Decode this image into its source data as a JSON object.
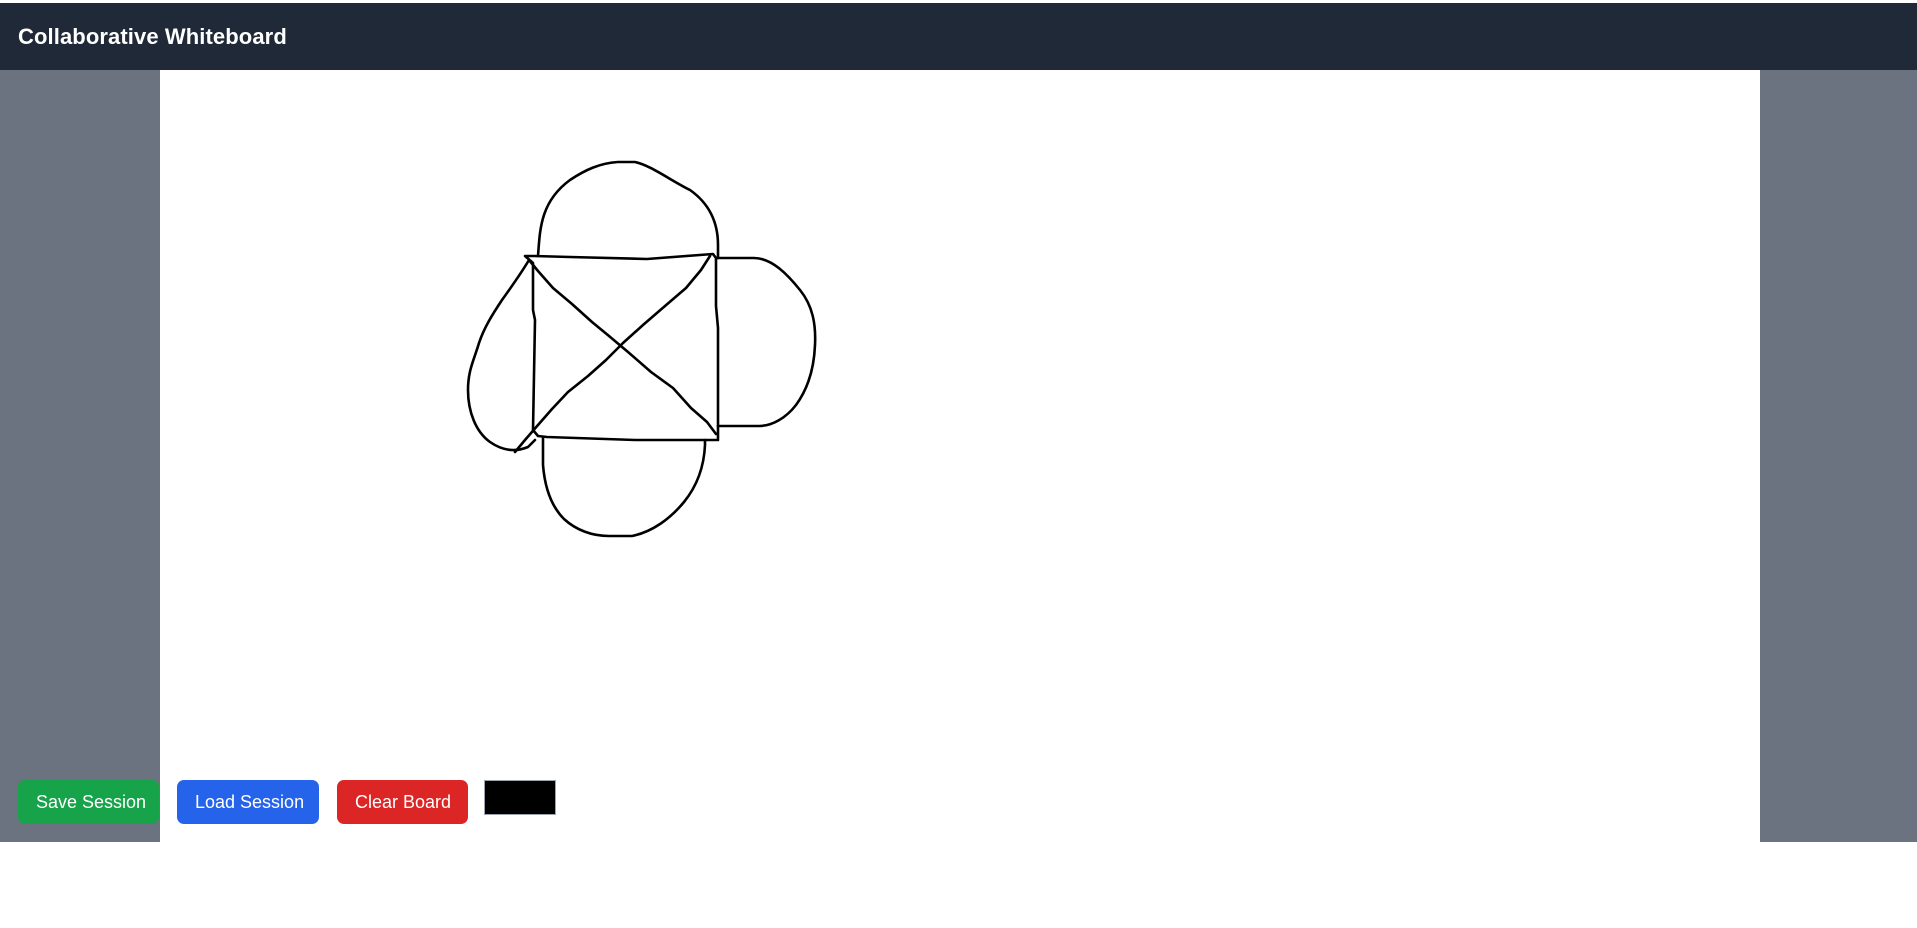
{
  "header": {
    "title": "Collaborative Whiteboard",
    "background_color": "#1f2937"
  },
  "workspace": {
    "background_color": "#6b7280",
    "board_background_color": "#ffffff",
    "stroke_color": "#000000"
  },
  "toolbar": {
    "save_label": "Save Session",
    "save_color": "#16a34a",
    "load_label": "Load Session",
    "load_color": "#2563eb",
    "clear_label": "Clear Board",
    "clear_color": "#dc2626",
    "selected_color": "#000000"
  }
}
